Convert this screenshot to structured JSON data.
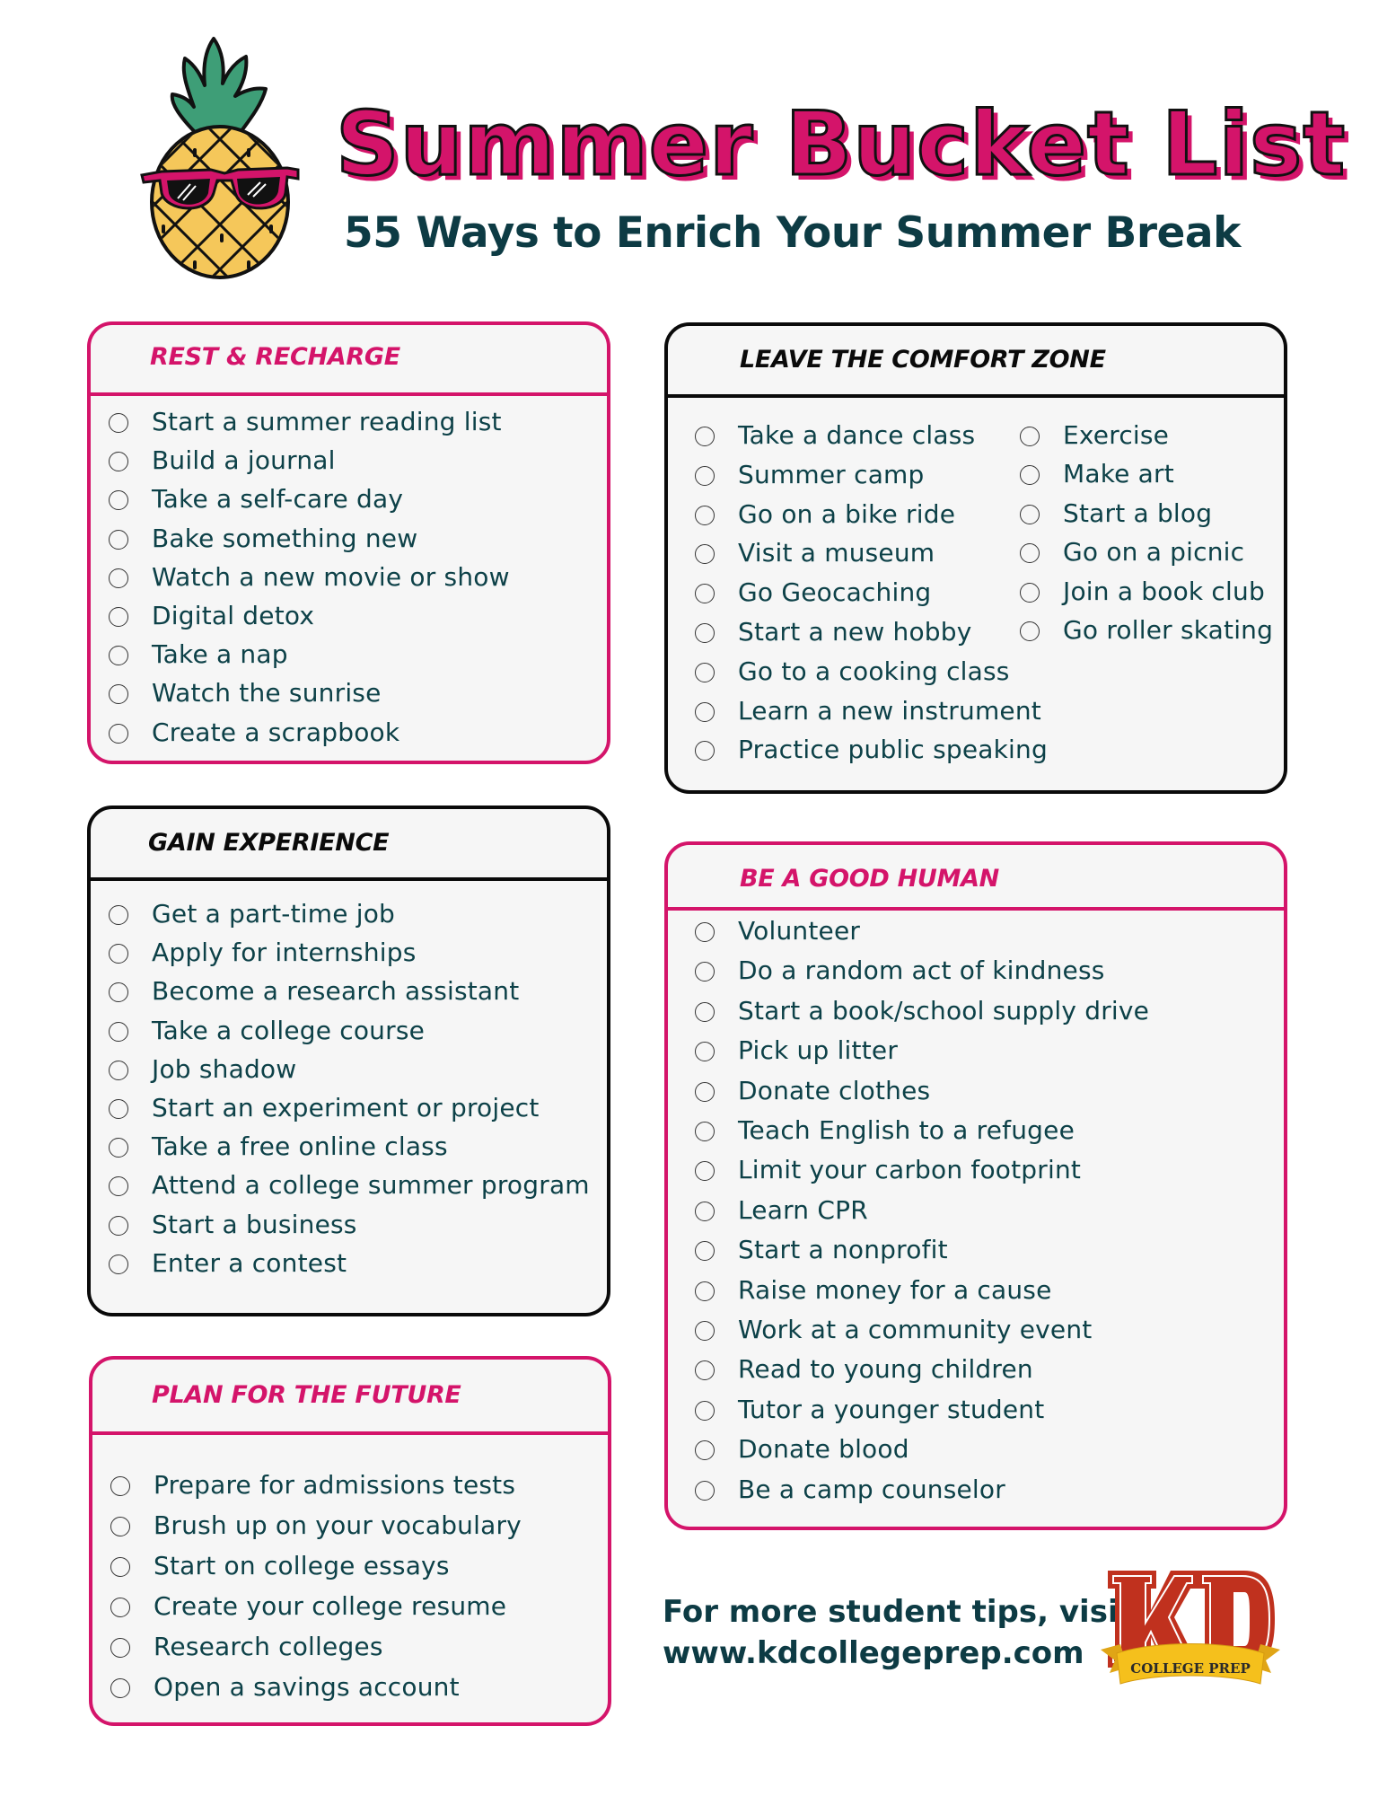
{
  "header": {
    "title": "Summer Bucket List",
    "subtitle": "55 Ways to Enrich Your Summer Break",
    "mascot_icon": "pineapple-with-sunglasses-icon"
  },
  "colors": {
    "accent_pink": "#d4146a",
    "text_teal": "#0d4148",
    "heading_dark": "#0d3b44",
    "box_fill": "#f6f6f6",
    "logo_red": "#c0311e",
    "logo_gold": "#f5c01c"
  },
  "sections": {
    "rest": {
      "title": "REST & RECHARGE",
      "items": [
        "Start a summer reading list",
        "Build a journal",
        "Take a self-care day",
        "Bake something new",
        "Watch a new movie or show",
        "Digital detox",
        "Take a nap",
        "Watch the sunrise",
        "Create a scrapbook"
      ]
    },
    "comfort": {
      "title": "LEAVE THE COMFORT ZONE",
      "items_col1": [
        "Take a dance class",
        "Summer camp",
        "Go on a bike ride",
        "Visit a museum",
        "Go Geocaching",
        "Start a new hobby",
        "Go to a cooking class",
        "Learn a new instrument",
        "Practice public speaking"
      ],
      "items_col2": [
        "Exercise",
        "Make art",
        "Start a blog",
        "Go on a picnic",
        "Join a book club",
        "Go roller skating"
      ]
    },
    "gain": {
      "title": "GAIN EXPERIENCE",
      "items": [
        "Get a part-time job",
        "Apply for internships",
        "Become a research assistant",
        "Take a college course",
        "Job shadow",
        "Start an experiment or project",
        "Take a free online class",
        "Attend a college summer program",
        "Start a business",
        "Enter a contest"
      ]
    },
    "good_human": {
      "title": "BE A GOOD HUMAN",
      "items": [
        "Volunteer",
        "Do a random act of kindness",
        "Start a book/school supply drive",
        "Pick up litter",
        "Donate clothes",
        "Teach English to a refugee",
        "Limit your carbon footprint",
        "Learn CPR",
        "Start a nonprofit",
        "Raise money for a cause",
        "Work at a community event",
        "Read to young children",
        "Tutor a younger student",
        "Donate blood",
        "Be a camp counselor"
      ]
    },
    "future": {
      "title": "PLAN FOR THE FUTURE",
      "items": [
        "Prepare for admissions tests",
        "Brush up on your vocabulary",
        "Start on college essays",
        "Create your college resume",
        "Research colleges",
        "Open a savings account"
      ]
    }
  },
  "footer": {
    "line1": "For more student tips, visit",
    "line2": "www.kdcollegeprep.com",
    "logo_letters": "KD",
    "logo_ribbon": "COLLEGE PREP",
    "logo_icon": "kd-college-prep-logo-icon"
  }
}
